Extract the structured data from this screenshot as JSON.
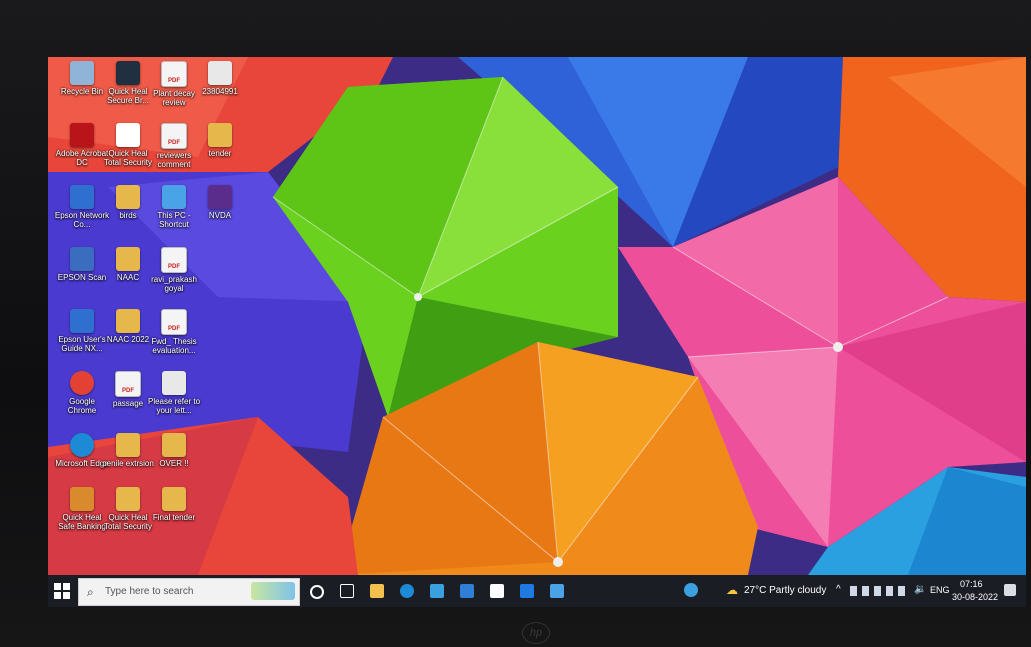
{
  "desktop": {
    "icons": [
      {
        "label": "Recycle Bin",
        "icon": "recycle-bin-icon",
        "color": "#8fb4d8"
      },
      {
        "label": "Quick Heal Secure Br...",
        "icon": "globe-icon",
        "color": "#203040"
      },
      {
        "label": "Plant decay review",
        "icon": "pdf-icon",
        "color": "#f4f4f4"
      },
      {
        "label": "23804991",
        "icon": "document-icon",
        "color": "#e8e8e8"
      },
      {
        "label": "Adobe Acrobat DC",
        "icon": "acrobat-icon",
        "color": "#b8141a"
      },
      {
        "label": "Quick Heal Total Security",
        "icon": "quick-heal-icon",
        "color": "#ffffff"
      },
      {
        "label": "reviewers comment",
        "icon": "pdf-icon",
        "color": "#f4f4f4"
      },
      {
        "label": "tender",
        "icon": "folder-icon",
        "color": "#e6b84c"
      },
      {
        "label": "Epson Network Co...",
        "icon": "epson-network-icon",
        "color": "#2f6fd0"
      },
      {
        "label": "birds",
        "icon": "folder-icon",
        "color": "#e6b84c"
      },
      {
        "label": "This PC - Shortcut",
        "icon": "computer-icon",
        "color": "#4aa3e6"
      },
      {
        "label": "NVDA",
        "icon": "nvda-icon",
        "color": "#5a2d8c"
      },
      {
        "label": "EPSON Scan",
        "icon": "epson-scan-icon",
        "color": "#3a6cc0"
      },
      {
        "label": "NAAC",
        "icon": "folder-icon",
        "color": "#e6b84c"
      },
      {
        "label": "ravi_prakash goyal",
        "icon": "pdf-icon",
        "color": "#f4f4f4"
      },
      {
        "label": "Epson User's Guide NX...",
        "icon": "epson-guide-icon",
        "color": "#2f6fd0"
      },
      {
        "label": "NAAC 2022",
        "icon": "folder-icon",
        "color": "#e6b84c"
      },
      {
        "label": "Fwd_ Thesis evaluation...",
        "icon": "pdf-icon",
        "color": "#f4f4f4"
      },
      {
        "label": "Google Chrome",
        "icon": "chrome-icon",
        "color": "#e34133"
      },
      {
        "label": "passage",
        "icon": "pdf-icon",
        "color": "#f4f4f4"
      },
      {
        "label": "Please refer to your lett...",
        "icon": "document-icon",
        "color": "#e8e8e8"
      },
      {
        "label": "Microsoft Edge",
        "icon": "edge-icon",
        "color": "#1d8ad6"
      },
      {
        "label": "penile extrsion",
        "icon": "folder-icon",
        "color": "#e6b84c"
      },
      {
        "label": "OVER !!",
        "icon": "folder-icon",
        "color": "#e6b84c"
      },
      {
        "label": "Quick Heal Safe Banking",
        "icon": "safe-banking-icon",
        "color": "#d88a2c"
      },
      {
        "label": "Quick Heal Total Security",
        "icon": "folder-icon",
        "color": "#e6b84c"
      },
      {
        "label": "Final tender",
        "icon": "folder-icon",
        "color": "#e6b84c"
      }
    ]
  },
  "taskbar": {
    "search_placeholder": "Type here to search",
    "weather": "27°C  Partly cloudy",
    "language": "ENG",
    "time": "07:16",
    "date": "30-08-2022",
    "apps": [
      {
        "icon": "cortana-icon",
        "color": "#ffffff"
      },
      {
        "icon": "task-view-icon",
        "color": "#ffffff"
      },
      {
        "icon": "file-explorer-icon",
        "color": "#f2c14e"
      },
      {
        "icon": "edge-icon",
        "color": "#1d8ad6"
      },
      {
        "icon": "microsoft-store-icon",
        "color": "#3aa0e0"
      },
      {
        "icon": "mail-icon",
        "color": "#2f7fd6"
      },
      {
        "icon": "amazon-icon",
        "color": "#ffffff"
      },
      {
        "icon": "dropbox-icon",
        "color": "#1e7ae0"
      },
      {
        "icon": "photos-icon",
        "color": "#4aa3e6"
      }
    ]
  },
  "monitor": {
    "brand": "hp"
  }
}
